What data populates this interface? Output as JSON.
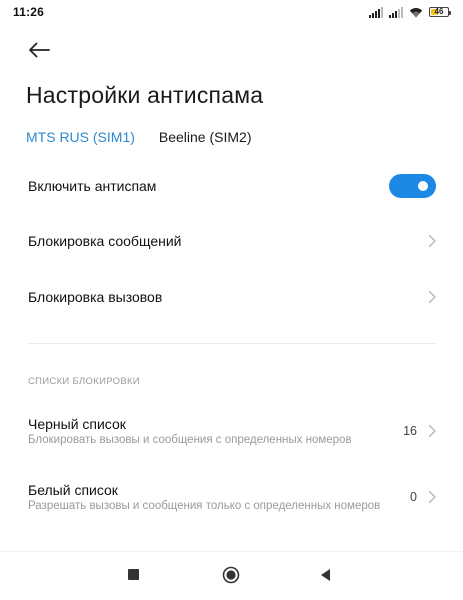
{
  "status_bar": {
    "time": "11:26",
    "battery_level": "46",
    "icons": [
      "signal-icon",
      "signal-icon",
      "wifi-icon",
      "battery-icon"
    ]
  },
  "header": {
    "back_icon": "arrow-left-icon",
    "title": "Настройки антиспама"
  },
  "sim_tabs": [
    {
      "label": "MTS RUS (SIM1)",
      "active": true
    },
    {
      "label": "Beeline (SIM2)",
      "active": false
    }
  ],
  "settings": {
    "enable_antispam": {
      "label": "Включить антиспам",
      "enabled": true
    },
    "block_messages": {
      "label": "Блокировка сообщений"
    },
    "block_calls": {
      "label": "Блокировка вызовов"
    }
  },
  "block_lists": {
    "section_title": "СПИСКИ БЛОКИРОВКИ",
    "blacklist": {
      "title": "Черный список",
      "subtitle": "Блокировать вызовы и сообщения с определенных номеров",
      "count": "16"
    },
    "whitelist": {
      "title": "Белый список",
      "subtitle": "Разрешать вызовы и сообщения только с определенных номеров",
      "count": "0"
    }
  },
  "nav_bar": {
    "icons": [
      "recents-square-icon",
      "home-circle-icon",
      "back-triangle-icon"
    ]
  },
  "colors": {
    "accent": "#1e88e5",
    "active_tab": "#2b8ad1",
    "secondary_text": "#9a9a9a"
  }
}
